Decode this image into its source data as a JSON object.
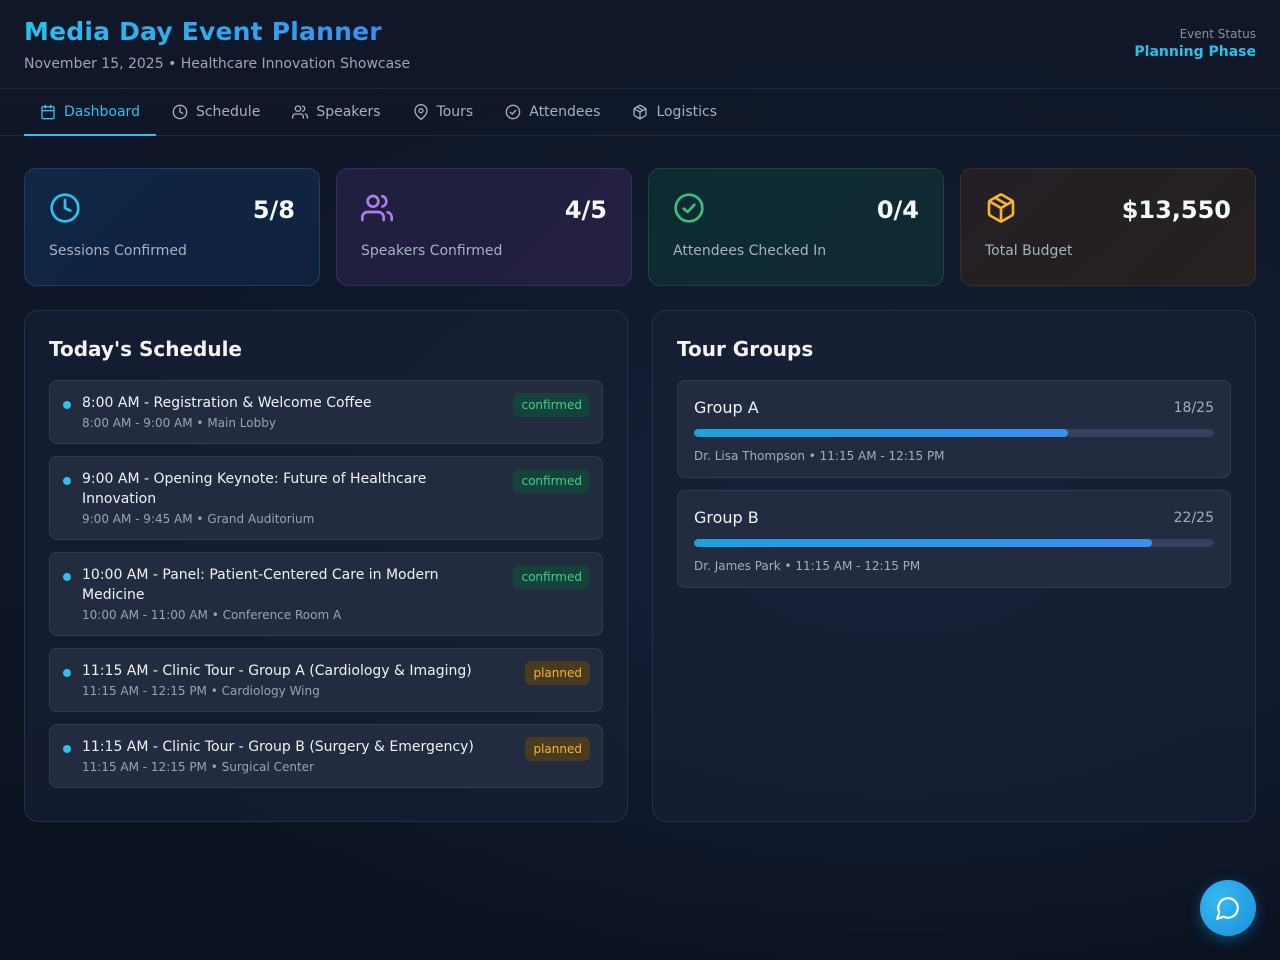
{
  "header": {
    "title": "Media Day Event Planner",
    "subtitle": "November 15, 2025 • Healthcare Innovation Showcase",
    "status_label": "Event Status",
    "status_value": "Planning Phase"
  },
  "tabs": [
    {
      "label": "Dashboard",
      "icon": "calendar-icon",
      "active": true
    },
    {
      "label": "Schedule",
      "icon": "clock-icon"
    },
    {
      "label": "Speakers",
      "icon": "users-icon"
    },
    {
      "label": "Tours",
      "icon": "map-pin-icon"
    },
    {
      "label": "Attendees",
      "icon": "check-circle-icon"
    },
    {
      "label": "Logistics",
      "icon": "box-icon"
    }
  ],
  "stats": [
    {
      "value": "5/8",
      "label": "Sessions Confirmed",
      "icon": "clock-icon",
      "color": "#2ec2ee"
    },
    {
      "value": "4/5",
      "label": "Speakers Confirmed",
      "icon": "users-icon",
      "color": "#b27cf2"
    },
    {
      "value": "0/4",
      "label": "Attendees Checked In",
      "icon": "check-circle-icon",
      "color": "#36c27a"
    },
    {
      "value": "$13,550",
      "label": "Total Budget",
      "icon": "box-icon",
      "color": "#f5b52a"
    }
  ],
  "schedule": {
    "title": "Today's Schedule",
    "items": [
      {
        "title": "8:00 AM - Registration & Welcome Coffee",
        "meta": "8:00 AM - 9:00 AM • Main Lobby",
        "status": "confirmed"
      },
      {
        "title": "9:00 AM - Opening Keynote: Future of Healthcare Innovation",
        "meta": "9:00 AM - 9:45 AM • Grand Auditorium",
        "status": "confirmed"
      },
      {
        "title": "10:00 AM - Panel: Patient-Centered Care in Modern Medicine",
        "meta": "10:00 AM - 11:00 AM • Conference Room A",
        "status": "confirmed"
      },
      {
        "title": "11:15 AM - Clinic Tour - Group A (Cardiology & Imaging)",
        "meta": "11:15 AM - 12:15 PM • Cardiology Wing",
        "status": "planned"
      },
      {
        "title": "11:15 AM - Clinic Tour - Group B (Surgery & Emergency)",
        "meta": "11:15 AM - 12:15 PM • Surgical Center",
        "status": "planned"
      }
    ]
  },
  "tours": {
    "title": "Tour Groups",
    "groups": [
      {
        "name": "Group A",
        "count": "18/25",
        "fill": 0.72,
        "meta": "Dr. Lisa Thompson • 11:15 AM - 12:15 PM"
      },
      {
        "name": "Group B",
        "count": "22/25",
        "fill": 0.88,
        "meta": "Dr. James Park • 11:15 AM - 12:15 PM"
      }
    ]
  },
  "chat_button": {
    "icon": "chat-bubble-icon"
  }
}
